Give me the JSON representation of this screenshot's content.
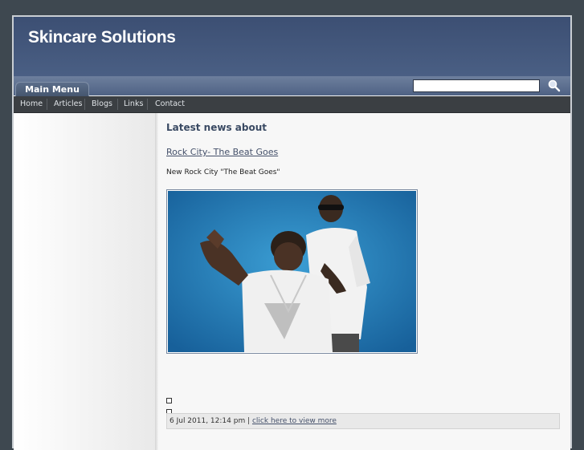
{
  "site": {
    "title": "Skincare Solutions"
  },
  "menu": {
    "tab_label": "Main Menu"
  },
  "search": {
    "value": "",
    "placeholder": "",
    "icon": "magnifier-icon"
  },
  "nav": [
    "Home",
    "Articles",
    "Blogs",
    "Links",
    "Contact"
  ],
  "main": {
    "section_title": "Latest news about",
    "article_title": "Rock City- The Beat Goes",
    "article_subtitle": "New Rock City \"The Beat Goes\"",
    "post_date": "6 Jul 2011, 12:14 pm |",
    "view_more": "click here to view more"
  },
  "colors": {
    "header": "#3c4f73",
    "navbar": "#3b3f43",
    "background": "#3e4850",
    "link": "#44506a"
  }
}
